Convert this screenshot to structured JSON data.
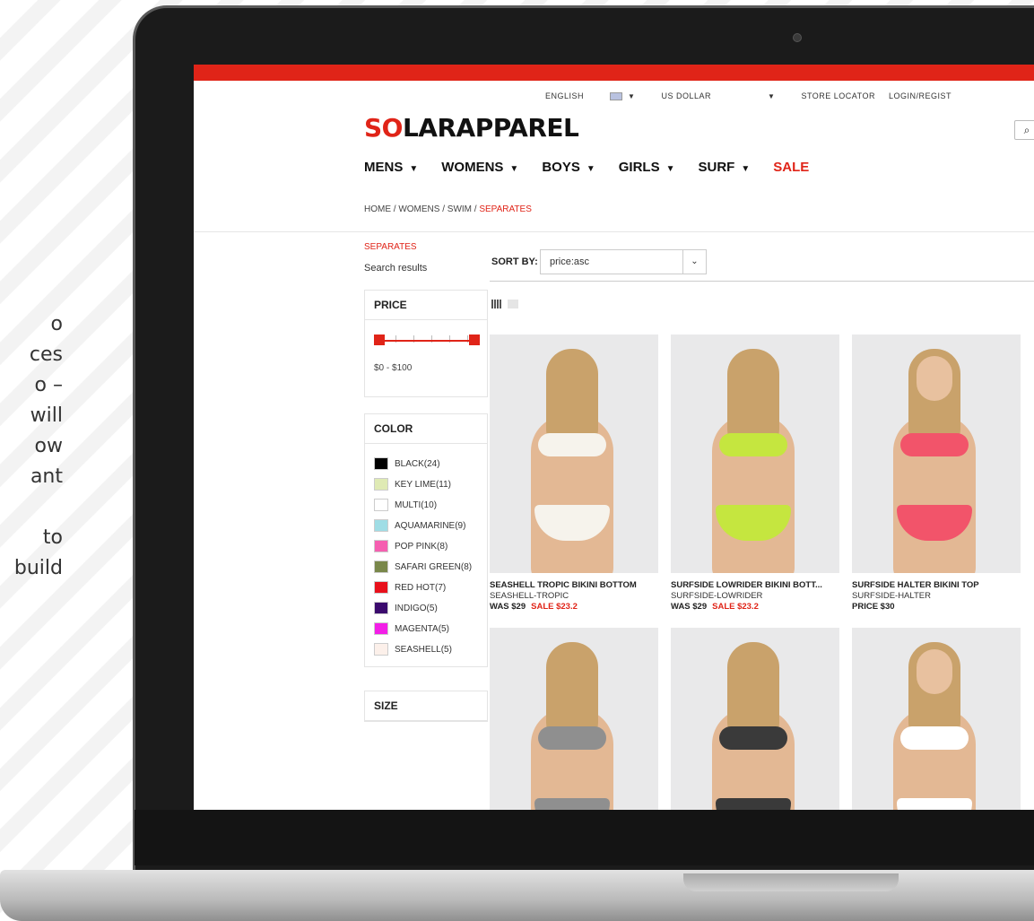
{
  "side_text": [
    "o",
    "ces",
    "o –",
    "will",
    "ow",
    "ant",
    "",
    "to",
    "build"
  ],
  "utility_bar": {
    "language": "ENGLISH",
    "currency": "US DOLLAR",
    "store_locator": "STORE LOCATOR",
    "login": "LOGIN/REGIST"
  },
  "brand": {
    "logo_prefix": "SO",
    "logo_rest": "LARAPPAREL",
    "accent": "#e02418"
  },
  "nav": [
    "MENS",
    "WOMENS",
    "BOYS",
    "GIRLS",
    "SURF"
  ],
  "nav_sale": "SALE",
  "breadcrumb": {
    "path": "HOME / WOMENS / SWIM / ",
    "current": "SEPARATES"
  },
  "sidebar": {
    "category": "SEPARATES",
    "subtitle": "Search results",
    "price_title": "PRICE",
    "price_range": "$0 - $100",
    "price_fraction_low": 0,
    "price_fraction_high": 1,
    "color_title": "COLOR",
    "colors": [
      {
        "label": "BLACK(24)",
        "hex": "#000000"
      },
      {
        "label": "KEY LIME(11)",
        "hex": "#dfeab4"
      },
      {
        "label": "MULTI(10)",
        "hex": "#ffffff"
      },
      {
        "label": "AQUAMARINE(9)",
        "hex": "#9fdde5"
      },
      {
        "label": "POP PINK(8)",
        "hex": "#f55fb0"
      },
      {
        "label": "SAFARI GREEN(8)",
        "hex": "#79874a"
      },
      {
        "label": "RED HOT(7)",
        "hex": "#e8101b"
      },
      {
        "label": "INDIGO(5)",
        "hex": "#3b0a6d"
      },
      {
        "label": "MAGENTA(5)",
        "hex": "#f31ee7"
      },
      {
        "label": "SEASHELL(5)",
        "hex": "#fcf0ea"
      }
    ],
    "size_title": "SIZE"
  },
  "sort": {
    "label": "SORT BY:",
    "value": "price:asc"
  },
  "products": [
    {
      "name": "SEASHELL TROPIC BIKINI BOTTOM",
      "sku": "SEASHELL-TROPIC",
      "was": "WAS $29",
      "sale": "SALE $23.2",
      "swimsuit": "#f6f3ec",
      "view": "back"
    },
    {
      "name": "SURFSIDE LOWRIDER BIKINI BOTT...",
      "sku": "SURFSIDE-LOWRIDER",
      "was": "WAS $29",
      "sale": "SALE $23.2",
      "swimsuit": "#c5e63f",
      "view": "back"
    },
    {
      "name": "SURFSIDE HALTER BIKINI TOP",
      "sku": "SURFSIDE-HALTER",
      "was": "PRICE $30",
      "sale": "",
      "swimsuit": "#f2546a",
      "view": "front"
    },
    {
      "name": "",
      "sku": "",
      "was": "",
      "sale": "",
      "swimsuit": "#8f8f8f",
      "view": "back"
    },
    {
      "name": "",
      "sku": "",
      "was": "",
      "sale": "",
      "swimsuit": "#3a3a3a",
      "view": "back"
    },
    {
      "name": "",
      "sku": "",
      "was": "",
      "sale": "",
      "swimsuit": "#ffffff",
      "view": "front"
    }
  ]
}
